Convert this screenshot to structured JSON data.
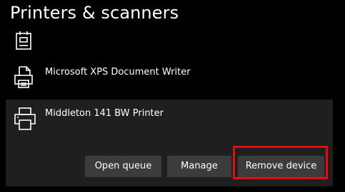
{
  "header": {
    "title": "Printers & scanners"
  },
  "devices": [
    {
      "name": "",
      "icon": "fax-icon"
    },
    {
      "name": "Microsoft XPS Document Writer",
      "icon": "document-printer-icon"
    },
    {
      "name": "Middleton 141 BW Printer",
      "icon": "printer-icon",
      "selected": true
    }
  ],
  "actions": {
    "open_queue_label": "Open queue",
    "manage_label": "Manage",
    "remove_label": "Remove device"
  },
  "colors": {
    "background": "#000000",
    "selected_item_background": "#1f1f1f",
    "button_background": "#3c3c3c",
    "highlight_border": "#e30d0d",
    "text": "#ffffff"
  }
}
